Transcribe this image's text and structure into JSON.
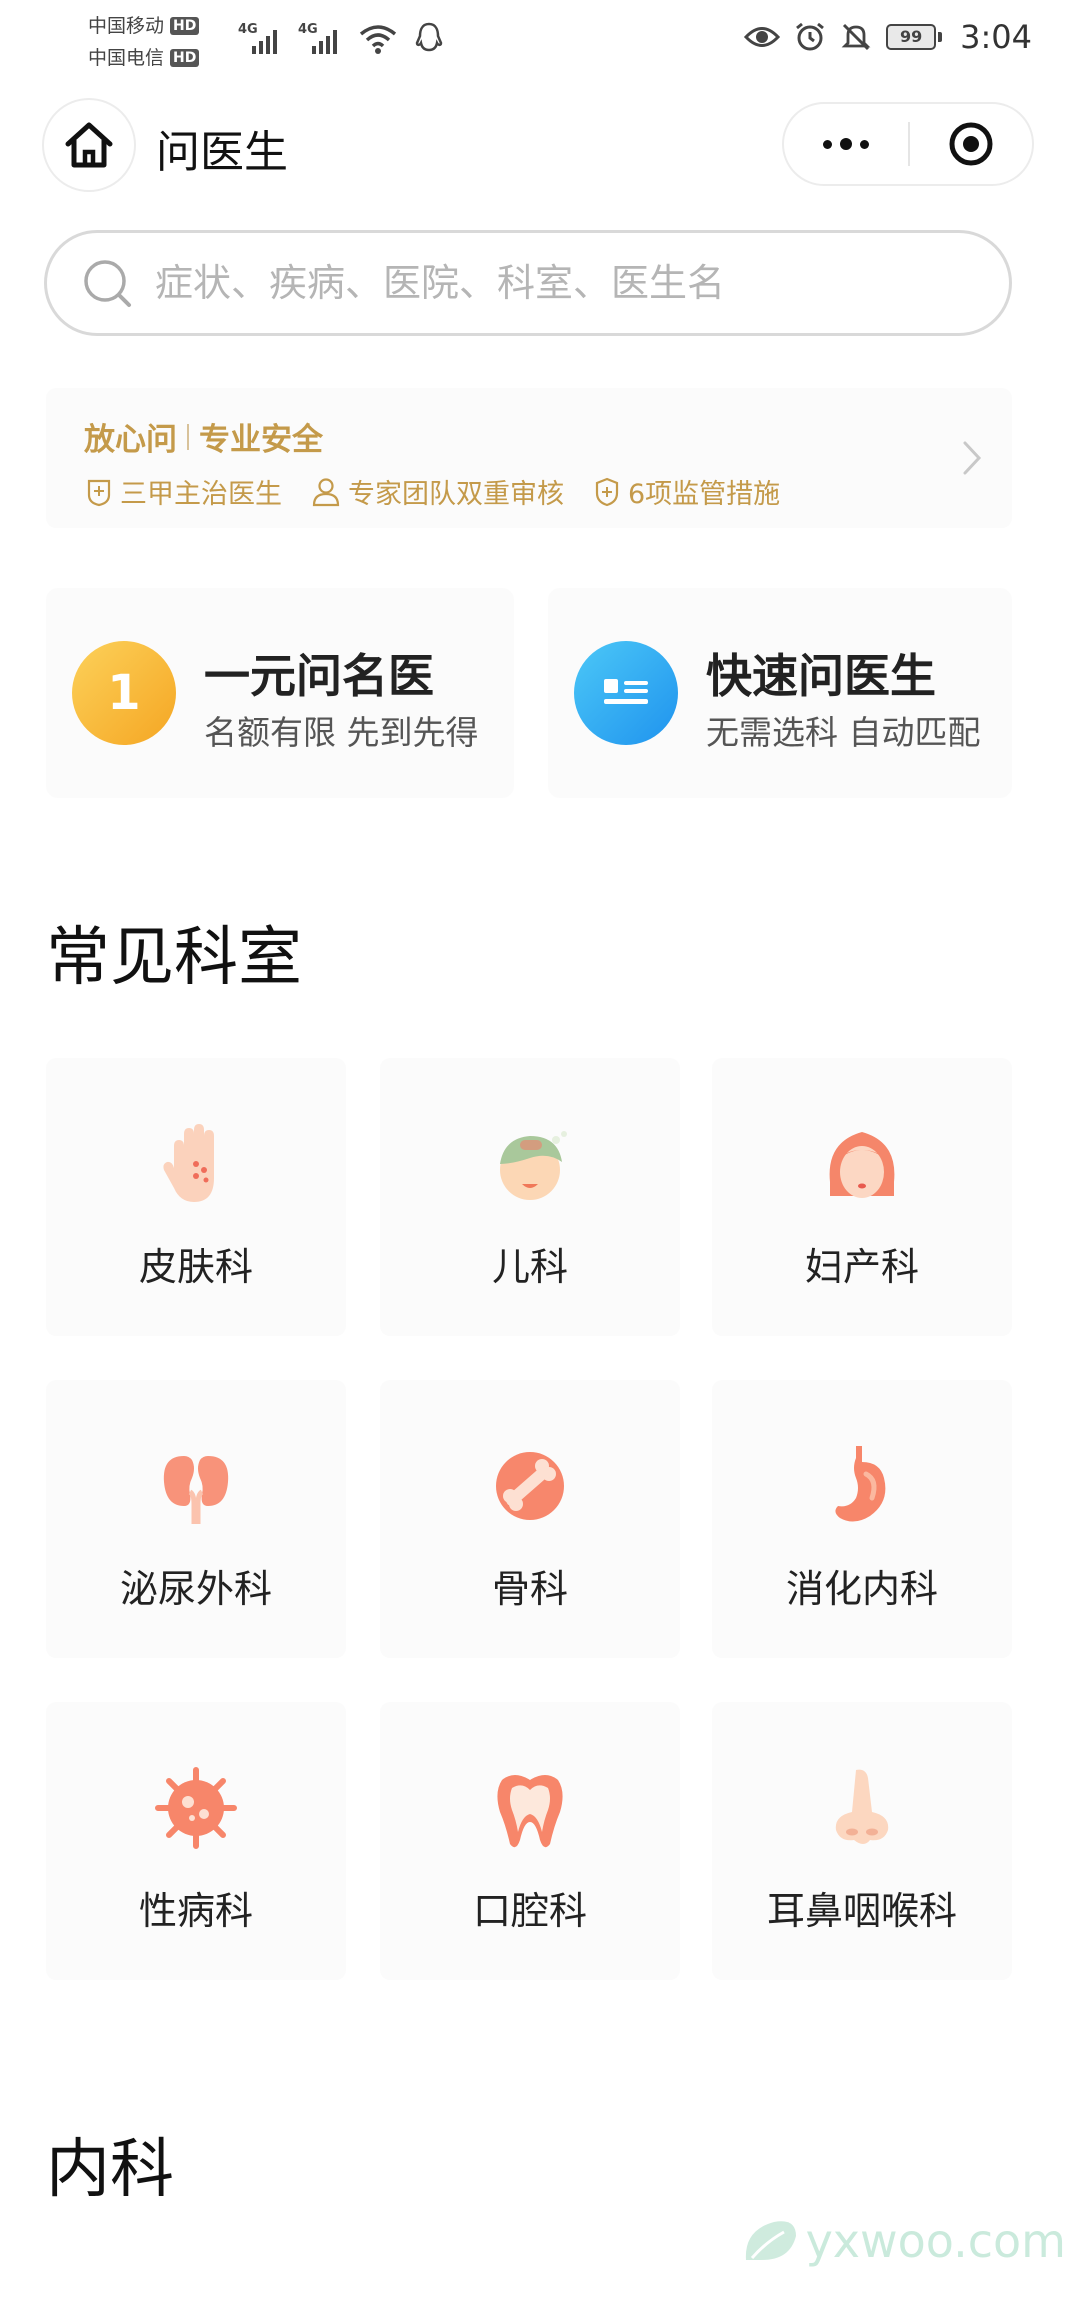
{
  "status_bar": {
    "carrier1": "中国移动",
    "carrier2": "中国电信",
    "hd": "HD",
    "network": "4G",
    "battery": "99",
    "time": "3:04"
  },
  "header": {
    "title": "问医生"
  },
  "search": {
    "placeholder": "症状、疾病、医院、科室、医生名"
  },
  "banner": {
    "title_a": "放心问",
    "title_b": "专业安全",
    "features": [
      "三甲主治医生",
      "专家团队双重审核",
      "6项监管措施"
    ]
  },
  "quick_cards": [
    {
      "icon_text": "1",
      "title": "一元问名医",
      "subtitle": "名额有限 先到先得"
    },
    {
      "title": "快速问医生",
      "subtitle": "无需选科 自动匹配"
    }
  ],
  "sections": {
    "common_departments": "常见科室",
    "internal_medicine": "内科"
  },
  "departments": [
    {
      "label": "皮肤科",
      "icon": "hand-skin-icon"
    },
    {
      "label": "儿科",
      "icon": "child-icon"
    },
    {
      "label": "妇产科",
      "icon": "woman-icon"
    },
    {
      "label": "泌尿外科",
      "icon": "kidney-icon"
    },
    {
      "label": "骨科",
      "icon": "bone-icon"
    },
    {
      "label": "消化内科",
      "icon": "stomach-icon"
    },
    {
      "label": "性病科",
      "icon": "virus-icon"
    },
    {
      "label": "口腔科",
      "icon": "tooth-icon"
    },
    {
      "label": "耳鼻咽喉科",
      "icon": "nose-icon"
    }
  ],
  "watermark": "yxwoo.com",
  "colors": {
    "gold": "#c49a4a",
    "orange_accent": "#f58a62",
    "yellow_badge": "#f7b52c",
    "blue_badge": "#2fa4f0"
  }
}
